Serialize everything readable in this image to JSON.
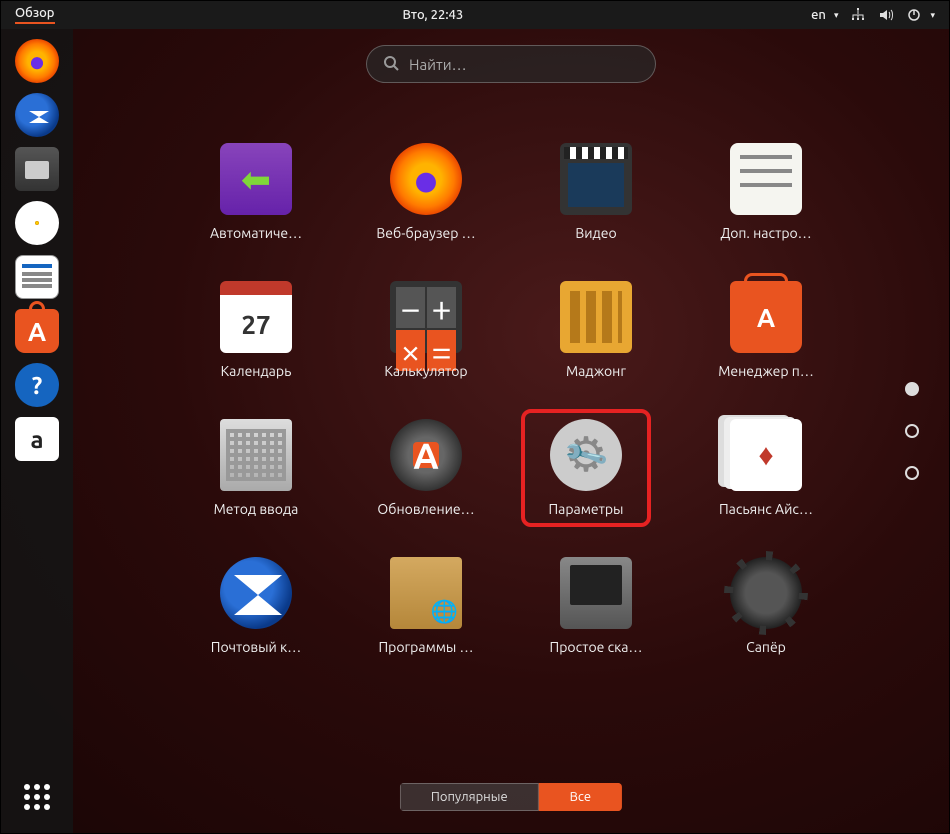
{
  "topbar": {
    "overview_label": "Обзор",
    "clock": "Вто, 22:43",
    "language": "en"
  },
  "search": {
    "placeholder": "Найти…"
  },
  "dock": [
    {
      "name": "firefox",
      "icon": "ic-firefox"
    },
    {
      "name": "thunderbird",
      "icon": "ic-thunderbird"
    },
    {
      "name": "files",
      "icon": "ic-files"
    },
    {
      "name": "rhythmbox",
      "icon": "ic-rhythmbox"
    },
    {
      "name": "libreoffice-writer",
      "icon": "ic-writer"
    },
    {
      "name": "software-center",
      "icon": "ic-software"
    },
    {
      "name": "help",
      "icon": "ic-help",
      "glyph": "?"
    },
    {
      "name": "amazon",
      "icon": "ic-amazon",
      "glyph": "a"
    }
  ],
  "apps": [
    {
      "name": "backup",
      "label": "Автоматиче…",
      "icon": "ic-backup"
    },
    {
      "name": "firefox",
      "label": "Веб-браузер …",
      "icon": "ic-firefox"
    },
    {
      "name": "videos",
      "label": "Видео",
      "icon": "ic-video"
    },
    {
      "name": "tweaks",
      "label": "Доп. настро…",
      "icon": "ic-tweaks"
    },
    {
      "name": "calendar",
      "label": "Календарь",
      "icon": "ic-calendar"
    },
    {
      "name": "calculator",
      "label": "Калькулятор",
      "icon": "ic-calc"
    },
    {
      "name": "mahjongg",
      "label": "Маджонг",
      "icon": "ic-mahjong"
    },
    {
      "name": "software-manager",
      "label": "Менеджер п…",
      "icon": "ic-software"
    },
    {
      "name": "input-method",
      "label": "Метод ввода",
      "icon": "ic-keyboard"
    },
    {
      "name": "software-updater",
      "label": "Обновление…",
      "icon": "ic-updater"
    },
    {
      "name": "settings",
      "label": "Параметры",
      "icon": "ic-settings",
      "highlighted": true
    },
    {
      "name": "aisleriot",
      "label": "Пасьянс Айс…",
      "icon": "ic-solitaire"
    },
    {
      "name": "thunderbird",
      "label": "Почтовый к…",
      "icon": "ic-thunderbird"
    },
    {
      "name": "software-properties",
      "label": "Программы …",
      "icon": "ic-package"
    },
    {
      "name": "simple-scan",
      "label": "Простое ска…",
      "icon": "ic-scanner"
    },
    {
      "name": "mines",
      "label": "Сапёр",
      "icon": "ic-mines"
    }
  ],
  "tabs": {
    "frequent": "Популярные",
    "all": "Все",
    "active": "all"
  },
  "pages": {
    "count": 3,
    "current": 0
  }
}
